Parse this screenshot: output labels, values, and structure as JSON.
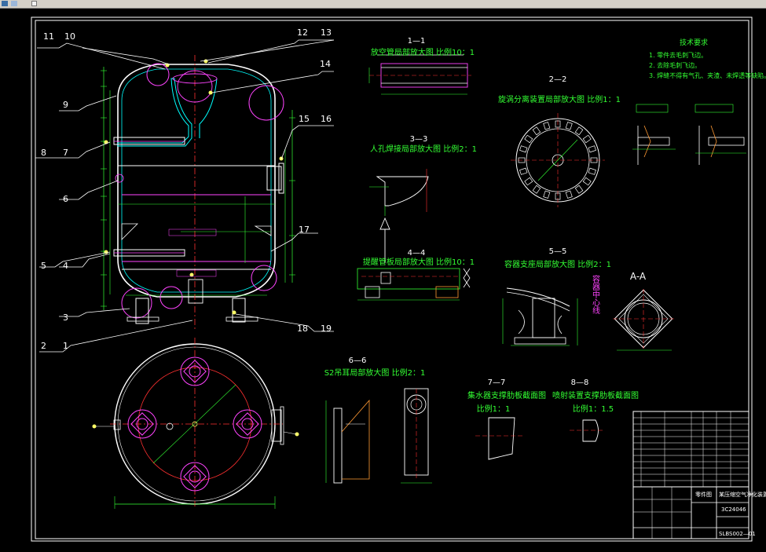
{
  "callouts": {
    "c1": "1",
    "c2": "2",
    "c3": "3",
    "c4": "4",
    "c5": "5",
    "c6": "6",
    "c7": "7",
    "c8": "8",
    "c9": "9",
    "c10": "10",
    "c11": "11",
    "c12": "12",
    "c13": "13",
    "c14": "14",
    "c15": "15",
    "c16": "16",
    "c17": "17",
    "c18": "18",
    "c19": "19"
  },
  "sections": {
    "s11": "1—1",
    "s11_title": "放空管局部放大图  比例10：1",
    "s22": "2—2",
    "s22_title": "旋涡分离装置局部放大图  比例1：1",
    "s33": "3—3",
    "s33_title": "人孔焊接局部放大图  比例2：1",
    "s44": "4—4",
    "s44_title": "提醒管板局部放大图  比例10：1",
    "s55": "5—5",
    "s55_title": "容器支座局部放大图  比例2：1",
    "sAA": "A-A",
    "s66": "6—6",
    "s66_title": "S2吊耳局部放大图  比例2：1",
    "s77": "7—7",
    "s77_title": "集水器支撑肋板截面图",
    "s77_scale": "比例1：1",
    "s88": "8—8",
    "s88_title": "喷射装置支撑肋板截面图",
    "s88_scale": "比例1：1.5"
  },
  "vertical_label": "容器中心线",
  "tech_req": {
    "title": "技术要求",
    "items": [
      "1. 零件去毛刺飞边。",
      "2. 去除毛刺飞边。",
      "3. 焊缝不得有气孔、夹渣、未焊透等缺陷。"
    ]
  },
  "title_block": {
    "part": "零件图",
    "name": "某压缩空气净化装置",
    "drawing": "3C24046",
    "number": "SLBS002—01"
  }
}
